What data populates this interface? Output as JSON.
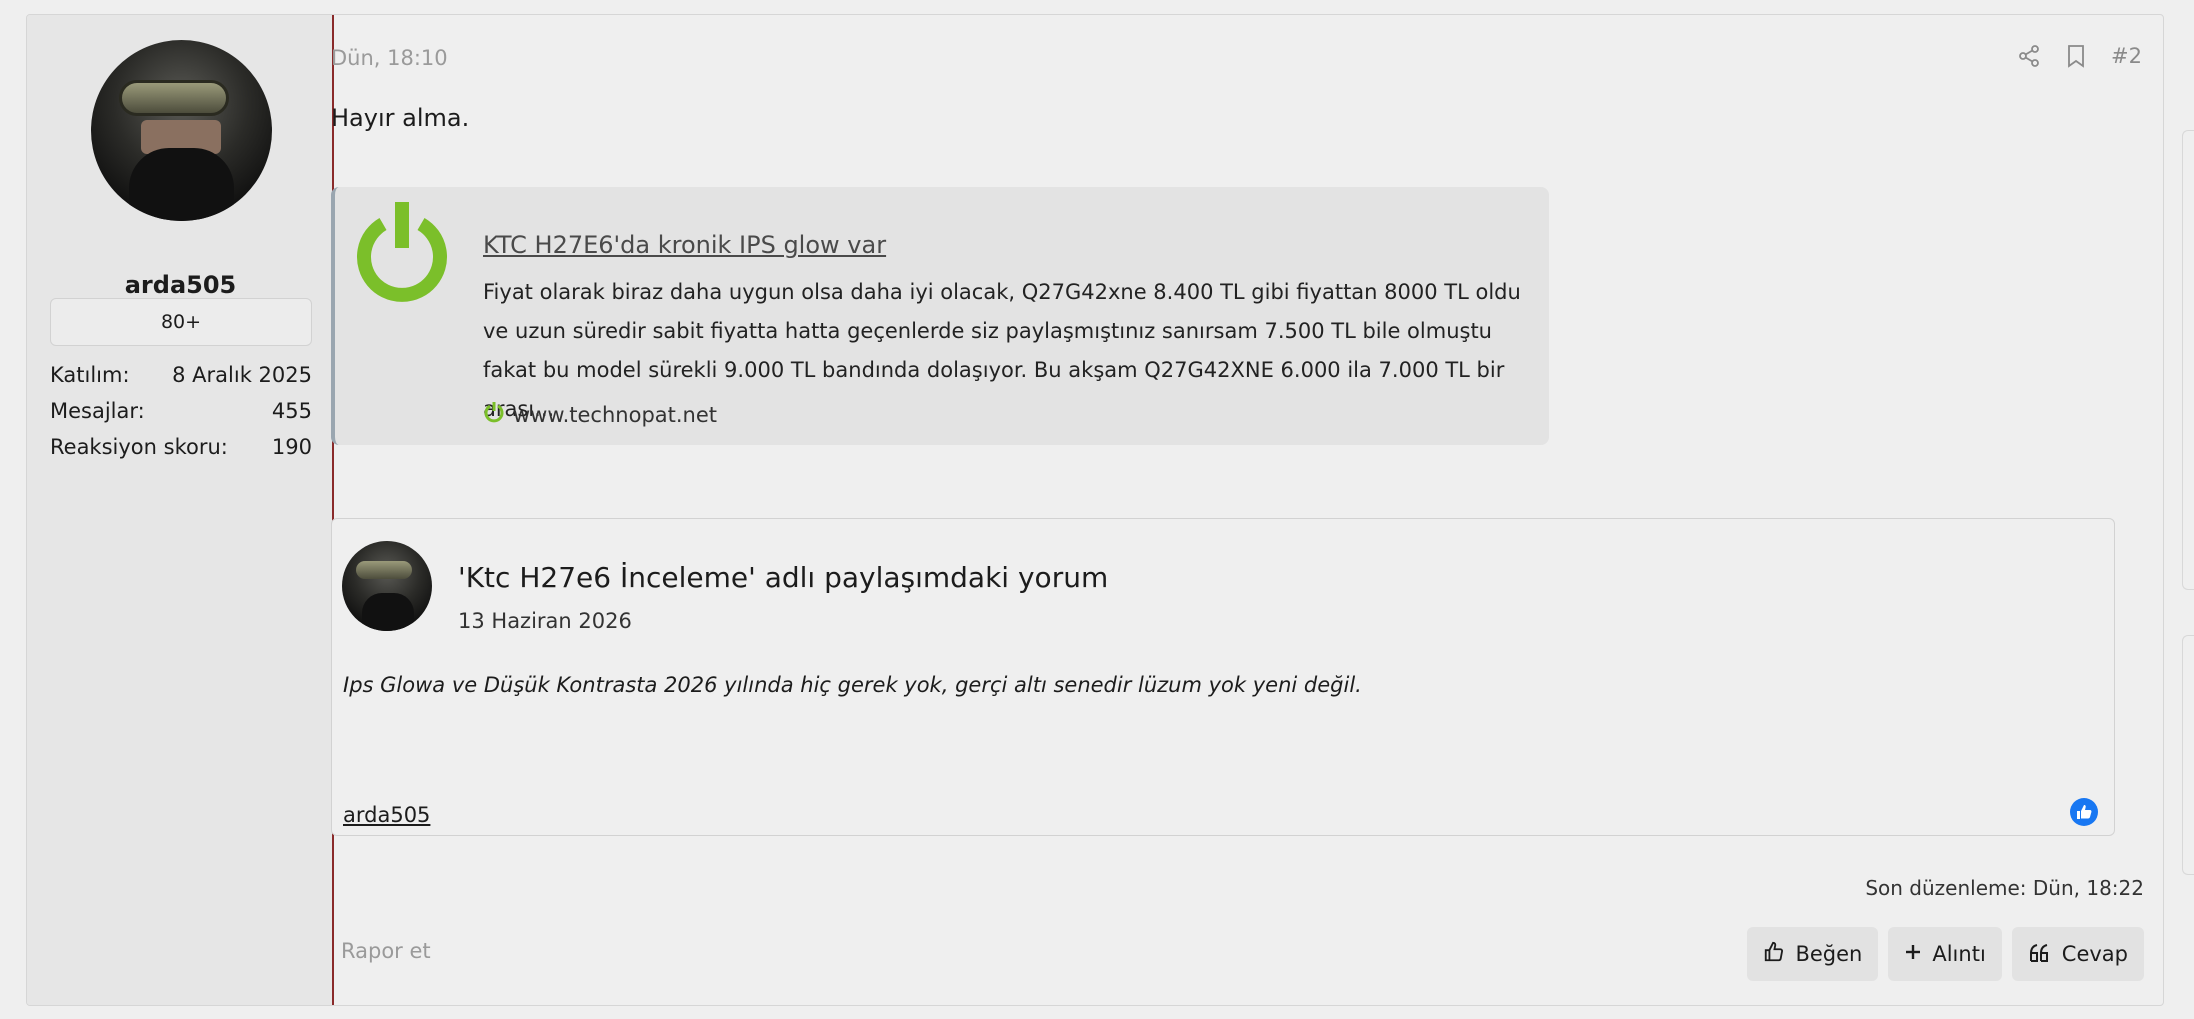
{
  "post": {
    "date": "Dün, 18:10",
    "number": "#2",
    "message": "Hayır alma.",
    "edit_note": "Son düzenleme: Dün, 18:22",
    "report_label": "Rapor et"
  },
  "user": {
    "name": "arda505",
    "badge": "80+",
    "stats": [
      {
        "label": "Katılım:",
        "value": "8 Aralık 2025"
      },
      {
        "label": "Mesajlar:",
        "value": "455"
      },
      {
        "label": "Reaksiyon skoru:",
        "value": "190"
      }
    ]
  },
  "unfurl": {
    "title": "KTC H27E6'da kronik IPS glow var",
    "description": "Fiyat olarak biraz daha uygun olsa daha iyi olacak, Q27G42xne 8.400 TL gibi fiyattan 8000 TL oldu ve uzun süredir sabit fiyatta hatta geçenlerde siz paylaşmıştınız sanırsam 7.500 TL bile olmuştu fakat bu model sürekli 9.000 TL bandında dolaşıyor. Bu akşam Q27G42XNE 6.000 ila 7.000 TL bir arası...",
    "domain": "www.technopat.net",
    "icon": "power-icon",
    "icon_color": "#7bbf2a"
  },
  "quote": {
    "title": "'Ktc H27e6 İnceleme' adlı paylaşımdaki yorum",
    "date": "13 Haziran 2026",
    "body": "Ips Glowa ve Düşük Kontrasta 2026 yılında hiç gerek yok, gerçi altı senedir lüzum yok yeni değil.",
    "author": "arda505",
    "like_color": "#1877f2"
  },
  "actions": {
    "like": "Beğen",
    "quote": "Alıntı",
    "reply": "Cevap"
  }
}
